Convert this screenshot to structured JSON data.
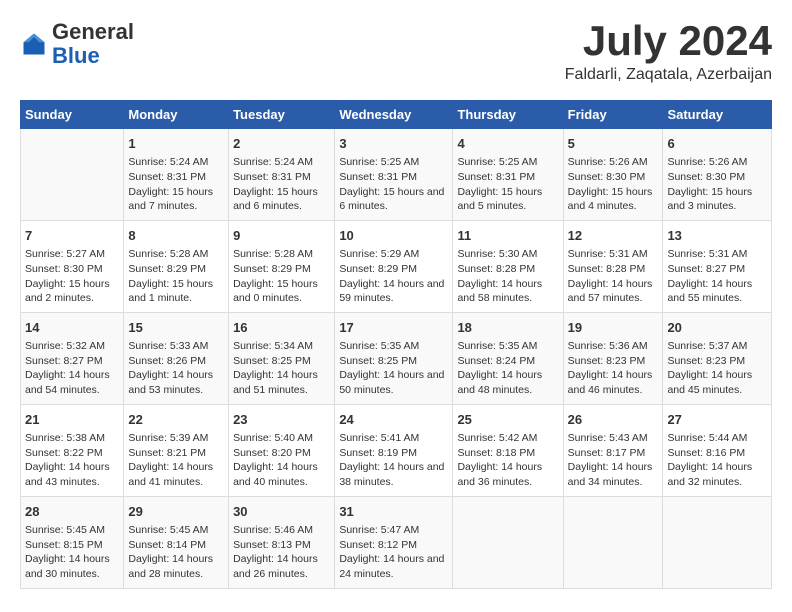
{
  "logo": {
    "general": "General",
    "blue": "Blue"
  },
  "title": "July 2024",
  "location": "Faldarli, Zaqatala, Azerbaijan",
  "headers": [
    "Sunday",
    "Monday",
    "Tuesday",
    "Wednesday",
    "Thursday",
    "Friday",
    "Saturday"
  ],
  "weeks": [
    [
      {
        "num": "",
        "sunrise": "",
        "sunset": "",
        "daylight": ""
      },
      {
        "num": "1",
        "sunrise": "Sunrise: 5:24 AM",
        "sunset": "Sunset: 8:31 PM",
        "daylight": "Daylight: 15 hours and 7 minutes."
      },
      {
        "num": "2",
        "sunrise": "Sunrise: 5:24 AM",
        "sunset": "Sunset: 8:31 PM",
        "daylight": "Daylight: 15 hours and 6 minutes."
      },
      {
        "num": "3",
        "sunrise": "Sunrise: 5:25 AM",
        "sunset": "Sunset: 8:31 PM",
        "daylight": "Daylight: 15 hours and 6 minutes."
      },
      {
        "num": "4",
        "sunrise": "Sunrise: 5:25 AM",
        "sunset": "Sunset: 8:31 PM",
        "daylight": "Daylight: 15 hours and 5 minutes."
      },
      {
        "num": "5",
        "sunrise": "Sunrise: 5:26 AM",
        "sunset": "Sunset: 8:30 PM",
        "daylight": "Daylight: 15 hours and 4 minutes."
      },
      {
        "num": "6",
        "sunrise": "Sunrise: 5:26 AM",
        "sunset": "Sunset: 8:30 PM",
        "daylight": "Daylight: 15 hours and 3 minutes."
      }
    ],
    [
      {
        "num": "7",
        "sunrise": "Sunrise: 5:27 AM",
        "sunset": "Sunset: 8:30 PM",
        "daylight": "Daylight: 15 hours and 2 minutes."
      },
      {
        "num": "8",
        "sunrise": "Sunrise: 5:28 AM",
        "sunset": "Sunset: 8:29 PM",
        "daylight": "Daylight: 15 hours and 1 minute."
      },
      {
        "num": "9",
        "sunrise": "Sunrise: 5:28 AM",
        "sunset": "Sunset: 8:29 PM",
        "daylight": "Daylight: 15 hours and 0 minutes."
      },
      {
        "num": "10",
        "sunrise": "Sunrise: 5:29 AM",
        "sunset": "Sunset: 8:29 PM",
        "daylight": "Daylight: 14 hours and 59 minutes."
      },
      {
        "num": "11",
        "sunrise": "Sunrise: 5:30 AM",
        "sunset": "Sunset: 8:28 PM",
        "daylight": "Daylight: 14 hours and 58 minutes."
      },
      {
        "num": "12",
        "sunrise": "Sunrise: 5:31 AM",
        "sunset": "Sunset: 8:28 PM",
        "daylight": "Daylight: 14 hours and 57 minutes."
      },
      {
        "num": "13",
        "sunrise": "Sunrise: 5:31 AM",
        "sunset": "Sunset: 8:27 PM",
        "daylight": "Daylight: 14 hours and 55 minutes."
      }
    ],
    [
      {
        "num": "14",
        "sunrise": "Sunrise: 5:32 AM",
        "sunset": "Sunset: 8:27 PM",
        "daylight": "Daylight: 14 hours and 54 minutes."
      },
      {
        "num": "15",
        "sunrise": "Sunrise: 5:33 AM",
        "sunset": "Sunset: 8:26 PM",
        "daylight": "Daylight: 14 hours and 53 minutes."
      },
      {
        "num": "16",
        "sunrise": "Sunrise: 5:34 AM",
        "sunset": "Sunset: 8:25 PM",
        "daylight": "Daylight: 14 hours and 51 minutes."
      },
      {
        "num": "17",
        "sunrise": "Sunrise: 5:35 AM",
        "sunset": "Sunset: 8:25 PM",
        "daylight": "Daylight: 14 hours and 50 minutes."
      },
      {
        "num": "18",
        "sunrise": "Sunrise: 5:35 AM",
        "sunset": "Sunset: 8:24 PM",
        "daylight": "Daylight: 14 hours and 48 minutes."
      },
      {
        "num": "19",
        "sunrise": "Sunrise: 5:36 AM",
        "sunset": "Sunset: 8:23 PM",
        "daylight": "Daylight: 14 hours and 46 minutes."
      },
      {
        "num": "20",
        "sunrise": "Sunrise: 5:37 AM",
        "sunset": "Sunset: 8:23 PM",
        "daylight": "Daylight: 14 hours and 45 minutes."
      }
    ],
    [
      {
        "num": "21",
        "sunrise": "Sunrise: 5:38 AM",
        "sunset": "Sunset: 8:22 PM",
        "daylight": "Daylight: 14 hours and 43 minutes."
      },
      {
        "num": "22",
        "sunrise": "Sunrise: 5:39 AM",
        "sunset": "Sunset: 8:21 PM",
        "daylight": "Daylight: 14 hours and 41 minutes."
      },
      {
        "num": "23",
        "sunrise": "Sunrise: 5:40 AM",
        "sunset": "Sunset: 8:20 PM",
        "daylight": "Daylight: 14 hours and 40 minutes."
      },
      {
        "num": "24",
        "sunrise": "Sunrise: 5:41 AM",
        "sunset": "Sunset: 8:19 PM",
        "daylight": "Daylight: 14 hours and 38 minutes."
      },
      {
        "num": "25",
        "sunrise": "Sunrise: 5:42 AM",
        "sunset": "Sunset: 8:18 PM",
        "daylight": "Daylight: 14 hours and 36 minutes."
      },
      {
        "num": "26",
        "sunrise": "Sunrise: 5:43 AM",
        "sunset": "Sunset: 8:17 PM",
        "daylight": "Daylight: 14 hours and 34 minutes."
      },
      {
        "num": "27",
        "sunrise": "Sunrise: 5:44 AM",
        "sunset": "Sunset: 8:16 PM",
        "daylight": "Daylight: 14 hours and 32 minutes."
      }
    ],
    [
      {
        "num": "28",
        "sunrise": "Sunrise: 5:45 AM",
        "sunset": "Sunset: 8:15 PM",
        "daylight": "Daylight: 14 hours and 30 minutes."
      },
      {
        "num": "29",
        "sunrise": "Sunrise: 5:45 AM",
        "sunset": "Sunset: 8:14 PM",
        "daylight": "Daylight: 14 hours and 28 minutes."
      },
      {
        "num": "30",
        "sunrise": "Sunrise: 5:46 AM",
        "sunset": "Sunset: 8:13 PM",
        "daylight": "Daylight: 14 hours and 26 minutes."
      },
      {
        "num": "31",
        "sunrise": "Sunrise: 5:47 AM",
        "sunset": "Sunset: 8:12 PM",
        "daylight": "Daylight: 14 hours and 24 minutes."
      },
      {
        "num": "",
        "sunrise": "",
        "sunset": "",
        "daylight": ""
      },
      {
        "num": "",
        "sunrise": "",
        "sunset": "",
        "daylight": ""
      },
      {
        "num": "",
        "sunrise": "",
        "sunset": "",
        "daylight": ""
      }
    ]
  ]
}
